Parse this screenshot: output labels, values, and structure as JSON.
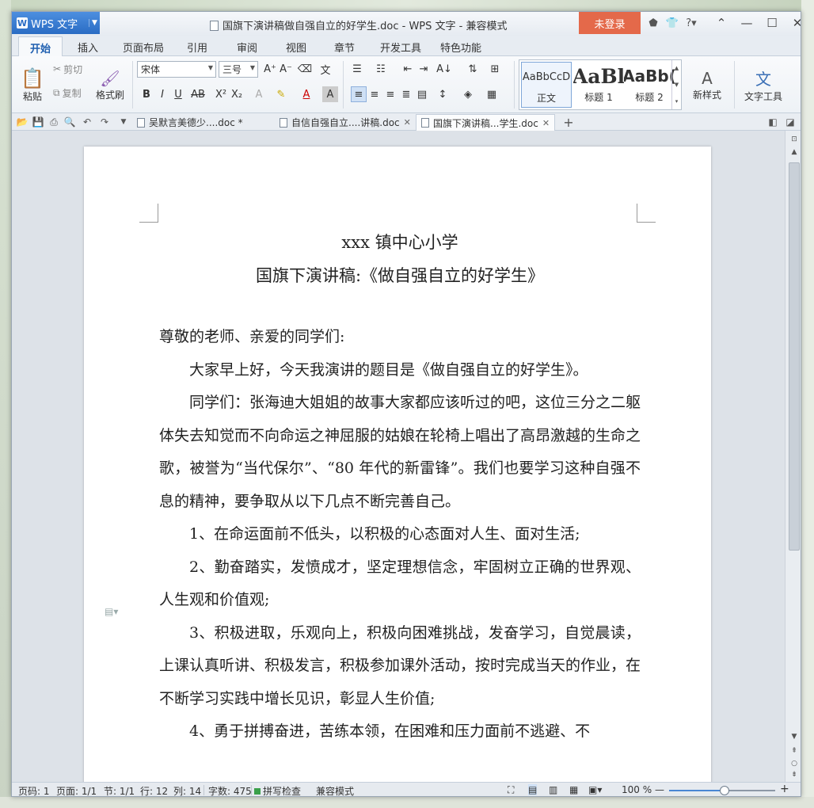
{
  "window": {
    "app_button": "WPS 文字",
    "title": "国旗下演讲稿做自强自立的好学生.doc - WPS 文字 - 兼容模式",
    "login": "未登录"
  },
  "menu_tabs": [
    "开始",
    "插入",
    "页面布局",
    "引用",
    "审阅",
    "视图",
    "章节",
    "开发工具",
    "特色功能"
  ],
  "ribbon": {
    "paste": "粘贴",
    "cut": "剪切",
    "copy": "复制",
    "format_painter": "格式刷",
    "font_name": "宋体",
    "font_size": "三号",
    "styles": [
      {
        "sample": "AaBbCcD",
        "name": "正文"
      },
      {
        "sample": "AaBl",
        "name": "标题 1"
      },
      {
        "sample": "AaBb(",
        "name": "标题 2"
      }
    ],
    "new_style": "新样式",
    "text_tools": "文字工具"
  },
  "doc_tabs": [
    {
      "label": "吴默言美德少....doc *",
      "active": false
    },
    {
      "label": "自信自强自立....讲稿.doc",
      "active": false
    },
    {
      "label": "国旗下演讲稿...学生.doc",
      "active": true
    }
  ],
  "document": {
    "title1": "xxx 镇中心小学",
    "title2": "国旗下演讲稿:《做自强自立的好学生》",
    "paragraphs": [
      {
        "text": "尊敬的老师、亲爱的同学们:",
        "indent": false
      },
      {
        "text": "大家早上好，今天我演讲的题目是《做自强自立的好学生》。",
        "indent": true
      },
      {
        "text": "同学们：张海迪大姐姐的故事大家都应该听过的吧，这位三分之二躯体失去知觉而不向命运之神屈服的姑娘在轮椅上唱出了高昂激越的生命之歌，被誉为“当代保尔”、“80 年代的新雷锋”。我们也要学习这种自强不息的精神，要争取从以下几点不断完善自己。",
        "indent": true
      },
      {
        "text": "1、在命运面前不低头，以积极的心态面对人生、面对生活;",
        "indent": true
      },
      {
        "text": "2、勤奋踏实，发愤成才，坚定理想信念，牢固树立正确的世界观、人生观和价值观;",
        "indent": true
      },
      {
        "text": "3、积极进取，乐观向上，积极向困难挑战，发奋学习，自觉晨读，上课认真听讲、积极发言，积极参加课外活动，按时完成当天的作业，在不断学习实践中增长见识，彰显人生价值;",
        "indent": true
      },
      {
        "text": "4、勇于拼搏奋进，苦练本领，在困难和压力面前不逃避、不",
        "indent": true
      }
    ]
  },
  "status": {
    "page_no": "页码: 1",
    "pages": "页面: 1/1",
    "section": "节: 1/1",
    "row": "行: 12",
    "col": "列: 14",
    "word_count": "字数: 475",
    "spell_check": "拼写检查",
    "compat_mode": "兼容模式",
    "zoom": "100 %",
    "zoom_level": 0.52
  },
  "colors": {
    "accent": "#2a6cc4",
    "login": "#e4694a"
  }
}
